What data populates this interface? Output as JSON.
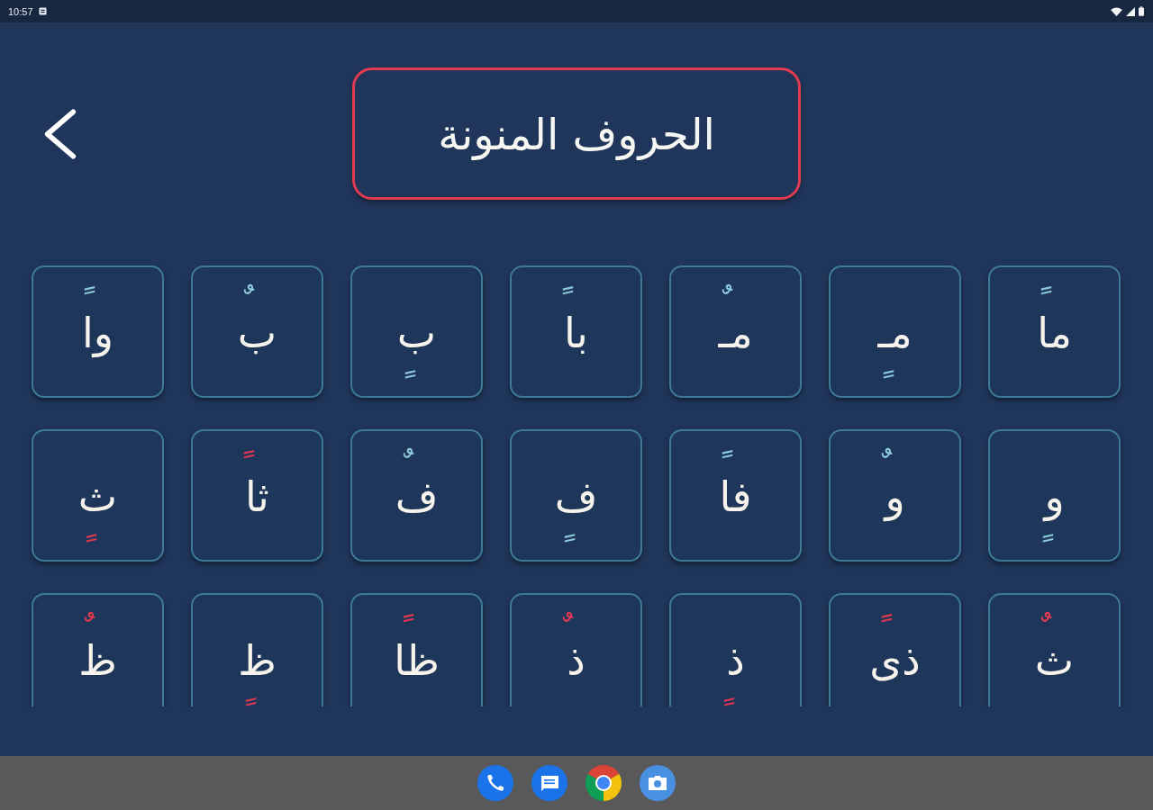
{
  "status_bar": {
    "time": "10:57"
  },
  "header": {
    "title": "الحروف المنونة"
  },
  "tiles": [
    {
      "letter": "ما",
      "tanween": "ً",
      "tanween_below": false,
      "color": "#8ccadc"
    },
    {
      "letter": "مـ",
      "tanween": "ٍ",
      "tanween_below": true,
      "color": "#8ccadc"
    },
    {
      "letter": "مـ",
      "tanween": "ٌ",
      "tanween_below": false,
      "color": "#8ccadc"
    },
    {
      "letter": "با",
      "tanween": "ً",
      "tanween_below": false,
      "color": "#8ccadc"
    },
    {
      "letter": "ب",
      "tanween": "ٍ",
      "tanween_below": true,
      "color": "#8ccadc"
    },
    {
      "letter": "ب",
      "tanween": "ٌ",
      "tanween_below": false,
      "color": "#8ccadc"
    },
    {
      "letter": "وا",
      "tanween": "ً",
      "tanween_below": false,
      "color": "#8ccadc"
    },
    {
      "letter": "و",
      "tanween": "ٍ",
      "tanween_below": true,
      "color": "#8ccadc"
    },
    {
      "letter": "و",
      "tanween": "ٌ",
      "tanween_below": false,
      "color": "#8ccadc"
    },
    {
      "letter": "فا",
      "tanween": "ً",
      "tanween_below": false,
      "color": "#8ccadc"
    },
    {
      "letter": "ف",
      "tanween": "ٍ",
      "tanween_below": true,
      "color": "#8ccadc"
    },
    {
      "letter": "ف",
      "tanween": "ٌ",
      "tanween_below": false,
      "color": "#8ccadc"
    },
    {
      "letter": "ثا",
      "tanween": "ً",
      "tanween_below": false,
      "color": "#e3384f"
    },
    {
      "letter": "ث",
      "tanween": "ٍ",
      "tanween_below": true,
      "color": "#e3384f"
    },
    {
      "letter": "ث",
      "tanween": "ٌ",
      "tanween_below": false,
      "color": "#e3384f"
    },
    {
      "letter": "ذى",
      "tanween": "ً",
      "tanween_below": false,
      "color": "#e3384f"
    },
    {
      "letter": "ذ",
      "tanween": "ٍ",
      "tanween_below": true,
      "color": "#e3384f"
    },
    {
      "letter": "ذ",
      "tanween": "ٌ",
      "tanween_below": false,
      "color": "#e3384f"
    },
    {
      "letter": "ظا",
      "tanween": "ً",
      "tanween_below": false,
      "color": "#e3384f"
    },
    {
      "letter": "ظ",
      "tanween": "ٍ",
      "tanween_below": true,
      "color": "#e3384f"
    },
    {
      "letter": "ظ",
      "tanween": "ٌ",
      "tanween_below": false,
      "color": "#e3384f"
    }
  ]
}
